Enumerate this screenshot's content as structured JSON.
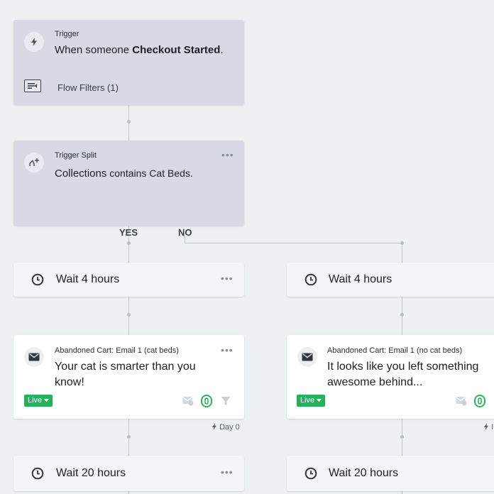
{
  "trigger": {
    "label": "Trigger",
    "text_prefix": "When someone",
    "text_bold": "Checkout Started",
    "text_suffix": ".",
    "filters_label": "Flow Filters (1)"
  },
  "trigger_split": {
    "label": "Trigger Split",
    "text_bold": "Collections",
    "text_rest": " contains Cat Beds.",
    "menu": "•••"
  },
  "branches": {
    "yes": "YES",
    "no": "NO"
  },
  "left": {
    "wait1": {
      "label": "Wait 4 hours",
      "menu": "•••"
    },
    "email": {
      "name": "Abandoned Cart: Email 1 (cat beds)",
      "subject": "Your cat is smarter than you know!",
      "status": "Live",
      "menu": "•••"
    },
    "day_label": "Day 0",
    "wait2": {
      "label": "Wait 20 hours",
      "menu": "•••"
    }
  },
  "right": {
    "wait1": {
      "label": "Wait 4 hours"
    },
    "email": {
      "name": "Abandoned Cart: Email 1 (no cat beds)",
      "subject": "It looks like you left something awesome behind...",
      "status": "Live"
    },
    "day_label": "I",
    "wait2": {
      "label": "Wait 20 hours"
    }
  },
  "colors": {
    "trigger_card": "#d7dae5",
    "live_badge": "#22b35a",
    "smart_send_icon": "#29b45c"
  },
  "icons": {
    "trigger": "lightning-icon",
    "split": "split-icon",
    "filter": "filter-list-icon",
    "wait": "clock-icon",
    "email": "envelope-icon"
  }
}
